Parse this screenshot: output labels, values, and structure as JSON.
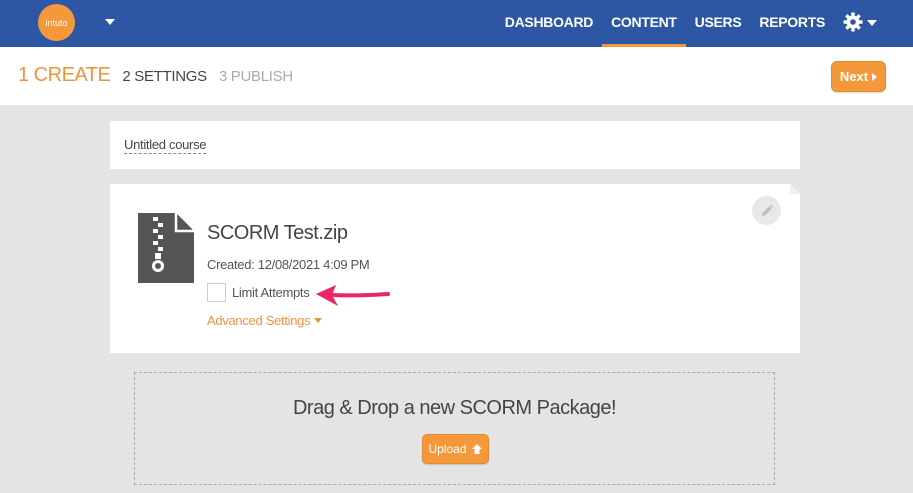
{
  "app": {
    "logo_text": "intuto",
    "brand_color": "#2d56a4",
    "accent_color": "#f5983a"
  },
  "nav": {
    "items": [
      {
        "label": "DASHBOARD",
        "active": false
      },
      {
        "label": "CONTENT",
        "active": true
      },
      {
        "label": "USERS",
        "active": false
      },
      {
        "label": "REPORTS",
        "active": false
      }
    ],
    "settings_icon": "gear-icon"
  },
  "steps": {
    "step1": "1 CREATE",
    "step2": "2 SETTINGS",
    "step3": "3 PUBLISH",
    "next_label": "Next"
  },
  "course": {
    "title": "Untitled course"
  },
  "file": {
    "icon": "zip-file-icon",
    "name": "SCORM Test.zip",
    "created": "Created: 12/08/2021 4:09 PM",
    "limit_attempts_label": "Limit Attempts",
    "limit_attempts_checked": false,
    "advanced_settings_label": "Advanced Settings"
  },
  "dropzone": {
    "text": "Drag & Drop a new SCORM Package!",
    "upload_label": "Upload"
  }
}
